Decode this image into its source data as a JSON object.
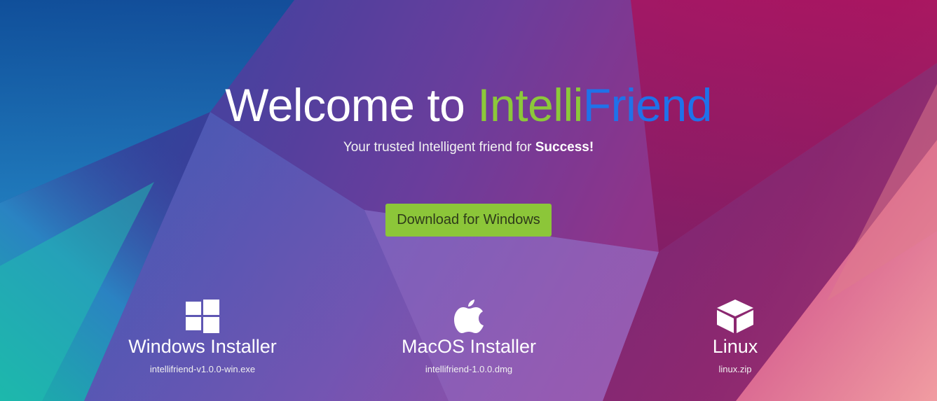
{
  "hero": {
    "title_prefix": "Welcome to ",
    "title_intelli": "Intelli",
    "title_friend": "Friend",
    "subtitle_text": "Your trusted Intelligent friend for ",
    "subtitle_bold": "Success!",
    "download_button": "Download for Windows"
  },
  "installers": [
    {
      "name": "Windows Installer",
      "file": "intellifriend-v1.0.0-win.exe",
      "icon": "windows-logo-icon"
    },
    {
      "name": "MacOS Installer",
      "file": "intellifriend-1.0.0.dmg",
      "icon": "apple-logo-icon"
    },
    {
      "name": "Linux",
      "file": "linux.zip",
      "icon": "package-box-icon"
    }
  ],
  "colors": {
    "accent_green": "#8cc83a",
    "accent_blue": "#1f72ea",
    "button_green": "#8cc639"
  }
}
